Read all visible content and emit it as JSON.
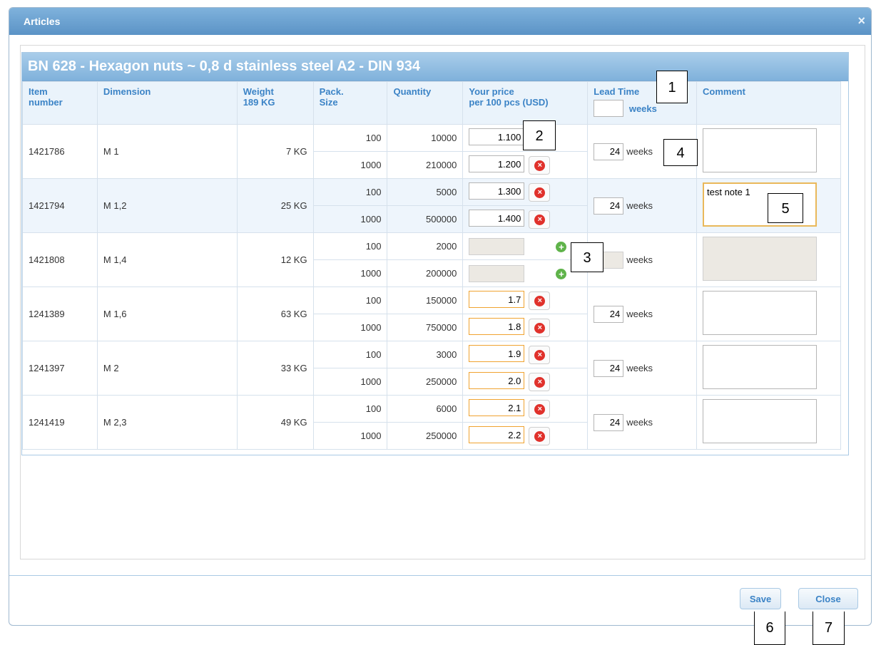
{
  "window": {
    "title": "Articles",
    "close_glyph": "×"
  },
  "panel": {
    "title": "BN 628 - Hexagon nuts ~ 0,8 d stainless steel A2  -  DIN 934"
  },
  "columns": {
    "item": "Item\nnumber",
    "dimension": "Dimension",
    "weight": "Weight\n189 KG",
    "pack": "Pack.\nSize",
    "quantity": "Quantity",
    "price": "Your price\nper 100 pcs (USD)",
    "lead": "Lead Time",
    "lead_unit": "weeks",
    "comment": "Comment"
  },
  "rows": [
    {
      "item": "1421786",
      "dim": "M 1",
      "weight": "7 KG",
      "lead": "24",
      "weeks": "weeks",
      "comment": "",
      "subs": [
        {
          "pack": "100",
          "qty": "10000",
          "price": "1.100"
        },
        {
          "pack": "1000",
          "qty": "210000",
          "price": "1.200"
        }
      ]
    },
    {
      "item": "1421794",
      "dim": "M 1,2",
      "weight": "25 KG",
      "lead": "24",
      "weeks": "weeks",
      "comment": "test note 1",
      "subs": [
        {
          "pack": "100",
          "qty": "5000",
          "price": "1.300"
        },
        {
          "pack": "1000",
          "qty": "500000",
          "price": "1.400"
        }
      ]
    },
    {
      "item": "1421808",
      "dim": "M 1,4",
      "weight": "12 KG",
      "lead": "",
      "weeks": "weeks",
      "comment": "",
      "subs": [
        {
          "pack": "100",
          "qty": "2000",
          "price": ""
        },
        {
          "pack": "1000",
          "qty": "200000",
          "price": ""
        }
      ]
    },
    {
      "item": "1241389",
      "dim": "M 1,6",
      "weight": "63 KG",
      "lead": "24",
      "weeks": "weeks",
      "comment": "",
      "subs": [
        {
          "pack": "100",
          "qty": "150000",
          "price": "1.7"
        },
        {
          "pack": "1000",
          "qty": "750000",
          "price": "1.8"
        }
      ]
    },
    {
      "item": "1241397",
      "dim": "M 2",
      "weight": "33 KG",
      "lead": "24",
      "weeks": "weeks",
      "comment": "",
      "subs": [
        {
          "pack": "100",
          "qty": "3000",
          "price": "1.9"
        },
        {
          "pack": "1000",
          "qty": "250000",
          "price": "2.0"
        }
      ]
    },
    {
      "item": "1241419",
      "dim": "M 2,3",
      "weight": "49 KG",
      "lead": "24",
      "weeks": "weeks",
      "comment": "",
      "subs": [
        {
          "pack": "100",
          "qty": "6000",
          "price": "2.1"
        },
        {
          "pack": "1000",
          "qty": "250000",
          "price": "2.2"
        }
      ]
    }
  ],
  "icons": {
    "delete": "×",
    "add": "+"
  },
  "buttons": {
    "save": "Save",
    "close": "Close"
  },
  "callouts": [
    "1",
    "2",
    "3",
    "4",
    "5",
    "6",
    "7"
  ],
  "colors": {
    "header_blue": "#7fb1db",
    "label_blue": "#3b83c6",
    "delete_red": "#e0312b",
    "add_green": "#5fb34a",
    "edited_orange": "#f0a330"
  }
}
